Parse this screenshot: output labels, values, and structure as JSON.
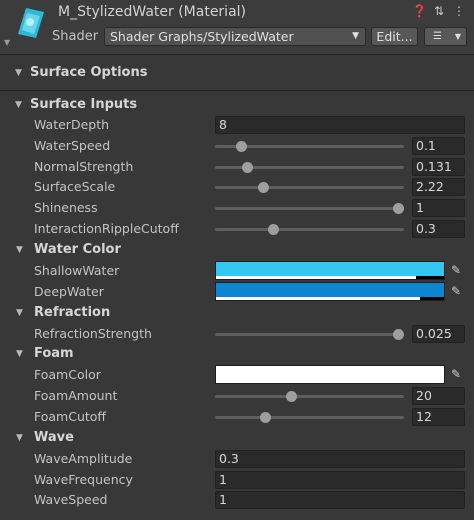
{
  "material": {
    "title": "M_StylizedWater (Material)",
    "shader_label": "Shader",
    "shader_value": "Shader Graphs/StylizedWater",
    "edit_label": "Edit...",
    "icons": [
      "help-icon",
      "preset-icon",
      "more-icon"
    ]
  },
  "sections": {
    "surface_options": "Surface Options",
    "surface_inputs": "Surface Inputs"
  },
  "groups": {
    "water_color": "Water Color",
    "refraction": "Refraction",
    "foam": "Foam",
    "wave": "Wave"
  },
  "props": {
    "water_depth": {
      "label": "WaterDepth",
      "value": "8"
    },
    "water_speed": {
      "label": "WaterSpeed",
      "value": "0.1",
      "level": 0.12
    },
    "normal_strength": {
      "label": "NormalStrength",
      "value": "0.131",
      "level": 0.15
    },
    "surface_scale": {
      "label": "SurfaceScale",
      "value": "2.22",
      "level": 0.24
    },
    "shininess": {
      "label": "Shineness",
      "value": "1",
      "level": 1.0
    },
    "interaction_ripple_cutoff": {
      "label": "InteractionRippleCutoff",
      "value": "0.3",
      "level": 0.3
    },
    "shallow_water": {
      "label": "ShallowWater",
      "color": "#33c6f0"
    },
    "deep_water": {
      "label": "DeepWater",
      "color": "#0d86d2"
    },
    "refraction_strength": {
      "label": "RefractionStrength",
      "value": "0.025",
      "level": 1.0
    },
    "foam_color": {
      "label": "FoamColor",
      "color": "#ffffff"
    },
    "foam_amount": {
      "label": "FoamAmount",
      "value": "20",
      "level": 0.4
    },
    "foam_cutoff": {
      "label": "FoamCutoff",
      "value": "12",
      "level": 0.25
    },
    "wave_amplitude": {
      "label": "WaveAmplitude",
      "value": "0.3"
    },
    "wave_frequency": {
      "label": "WaveFrequency",
      "value": "1"
    },
    "wave_speed": {
      "label": "WaveSpeed",
      "value": "1"
    }
  }
}
